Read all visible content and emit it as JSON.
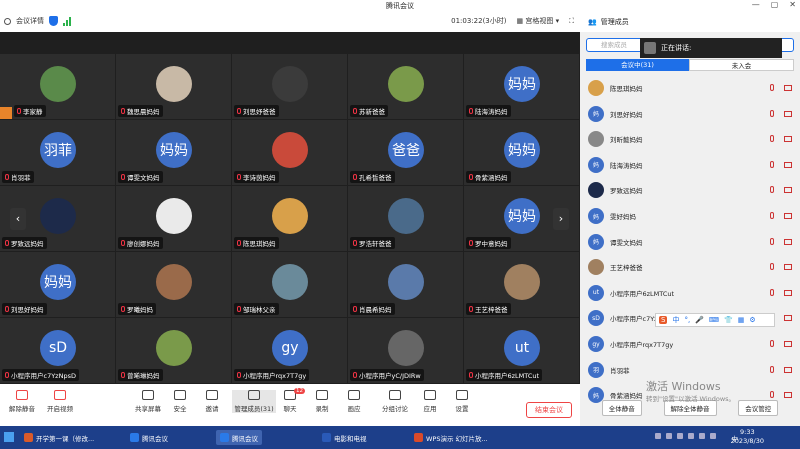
{
  "window": {
    "title": "腾讯会议",
    "controls": [
      "—",
      "▢",
      "✕"
    ]
  },
  "topbar": {
    "meeting_info": "会议详情",
    "timer": "01:03:22(3小时)",
    "view_label": "宫格视图",
    "fullscreen_icon": "⛶"
  },
  "grid": {
    "tiles": [
      {
        "name": "李家静",
        "avatar": "",
        "color": "#5a8a4a",
        "host": true
      },
      {
        "name": "魏思晨妈妈",
        "avatar": "",
        "color": "#c8b9a6"
      },
      {
        "name": "刘思妤爸爸",
        "avatar": "",
        "color": "#3b3b3b"
      },
      {
        "name": "苏新爸爸",
        "avatar": "",
        "color": "#7a9a4a"
      },
      {
        "name": "陆海涛妈妈",
        "avatar": "妈妈",
        "color": "#3f6fc7"
      },
      {
        "name": "肖羽菲",
        "avatar": "羽菲",
        "color": "#3f6fc7"
      },
      {
        "name": "谭雯文妈妈",
        "avatar": "妈妈",
        "color": "#3f6fc7"
      },
      {
        "name": "李诗茵妈妈",
        "avatar": "",
        "color": "#c94a3a"
      },
      {
        "name": "孔希皙爸爸",
        "avatar": "爸爸",
        "color": "#3f6fc7"
      },
      {
        "name": "骨紫涵妈妈",
        "avatar": "妈妈",
        "color": "#3f6fc7"
      },
      {
        "name": "罗致远妈妈",
        "avatar": "",
        "color": "#1d2a4a"
      },
      {
        "name": "廖创娜妈妈",
        "avatar": "",
        "color": "#eaeaea"
      },
      {
        "name": "陈思琪妈妈",
        "avatar": "",
        "color": "#d8a04a"
      },
      {
        "name": "罗浩轩爸爸",
        "avatar": "",
        "color": "#4a6a8a"
      },
      {
        "name": "罗中意妈妈",
        "avatar": "妈妈",
        "color": "#3f6fc7"
      },
      {
        "name": "刘思好妈妈",
        "avatar": "妈妈",
        "color": "#3f6fc7"
      },
      {
        "name": "罗曦妈妈",
        "avatar": "",
        "color": "#9a6a4a"
      },
      {
        "name": "邹瑞林父亲",
        "avatar": "",
        "color": "#6a8a9a"
      },
      {
        "name": "肖晨希妈妈",
        "avatar": "",
        "color": "#5a7aaa"
      },
      {
        "name": "王艺梓爸爸",
        "avatar": "",
        "color": "#a08060"
      },
      {
        "name": "小程序用户c7YzNpsD",
        "avatar": "sD",
        "color": "#3f6fc7"
      },
      {
        "name": "曾唏琳妈妈",
        "avatar": "",
        "color": "#7a9a4a"
      },
      {
        "name": "小程序用户rqx7T7gy",
        "avatar": "gy",
        "color": "#3f6fc7"
      },
      {
        "name": "小程序用户yC/JDIRw",
        "avatar": "",
        "color": "#666"
      },
      {
        "name": "小程序用户6zLMTCut",
        "avatar": "ut",
        "color": "#3f6fc7"
      }
    ],
    "prev_arrow": "‹",
    "next_arrow": "›"
  },
  "toolbar": {
    "buttons": [
      "解除静音",
      "开启视频",
      "共享屏幕",
      "安全",
      "邀请",
      "管理成员(31)",
      "聊天",
      "录制",
      "画应",
      "分组讨论",
      "应用",
      "设置"
    ],
    "chat_badge": "12",
    "end_label": "结束会议"
  },
  "panel": {
    "title": "管理成员",
    "search_placeholder": "搜索成员",
    "speaking_label": "正在讲话:",
    "tab_in": "会议中(31)",
    "tab_out": "未入会",
    "members": [
      {
        "name": "陈思琪妈妈",
        "avatar": "",
        "color": "#d8a04a"
      },
      {
        "name": "刘思好妈妈",
        "avatar": "妈",
        "color": "#3f6fc7"
      },
      {
        "name": "刘昕懿妈妈",
        "avatar": "",
        "color": "#888"
      },
      {
        "name": "陆海涛妈妈",
        "avatar": "妈",
        "color": "#3f6fc7"
      },
      {
        "name": "罗致远妈妈",
        "avatar": "",
        "color": "#1d2a4a"
      },
      {
        "name": "雯好妈妈",
        "avatar": "妈",
        "color": "#3f6fc7"
      },
      {
        "name": "谭雯文妈妈",
        "avatar": "妈",
        "color": "#3f6fc7"
      },
      {
        "name": "王艺梓爸爸",
        "avatar": "",
        "color": "#a08060"
      },
      {
        "name": "小程序用户6zLMTCut",
        "avatar": "ut",
        "color": "#3f6fc7"
      },
      {
        "name": "小程序用户c7YzNpsD",
        "avatar": "sD",
        "color": "#3f6fc7"
      },
      {
        "name": "小程序用户rqx7T7gy",
        "avatar": "gy",
        "color": "#3f6fc7"
      },
      {
        "name": "肖羽菲",
        "avatar": "羽",
        "color": "#3f6fc7"
      },
      {
        "name": "骨紫涵妈妈",
        "avatar": "妈",
        "color": "#3f6fc7"
      }
    ],
    "mute_all": "全体静音",
    "unmute_all": "解除全体静音",
    "manage": "会议管控"
  },
  "ime": {
    "glyph": "S",
    "items": [
      "中",
      "°,",
      "🎤",
      "⌨",
      "👕",
      "▦",
      "⚙"
    ]
  },
  "activation": {
    "line1": "激活 Windows",
    "line2": "转到\"设置\"以激活 Windows。"
  },
  "taskbar": {
    "items": [
      {
        "label": "开学第一课（修改...",
        "color": "#d95a2a"
      },
      {
        "label": "腾讯会议",
        "color": "#2a7ae8"
      },
      {
        "label": "腾讯会议",
        "color": "#2a7ae8"
      },
      {
        "label": "电影和电视",
        "color": "#2a5ab8"
      },
      {
        "label": "WPS演示 幻灯片放...",
        "color": "#d94a2a"
      }
    ],
    "tray_lang": "中",
    "time": "9:33",
    "date": "2023/8/30"
  },
  "colors": {
    "accent": "#1e6fe8",
    "danger": "#e44"
  }
}
